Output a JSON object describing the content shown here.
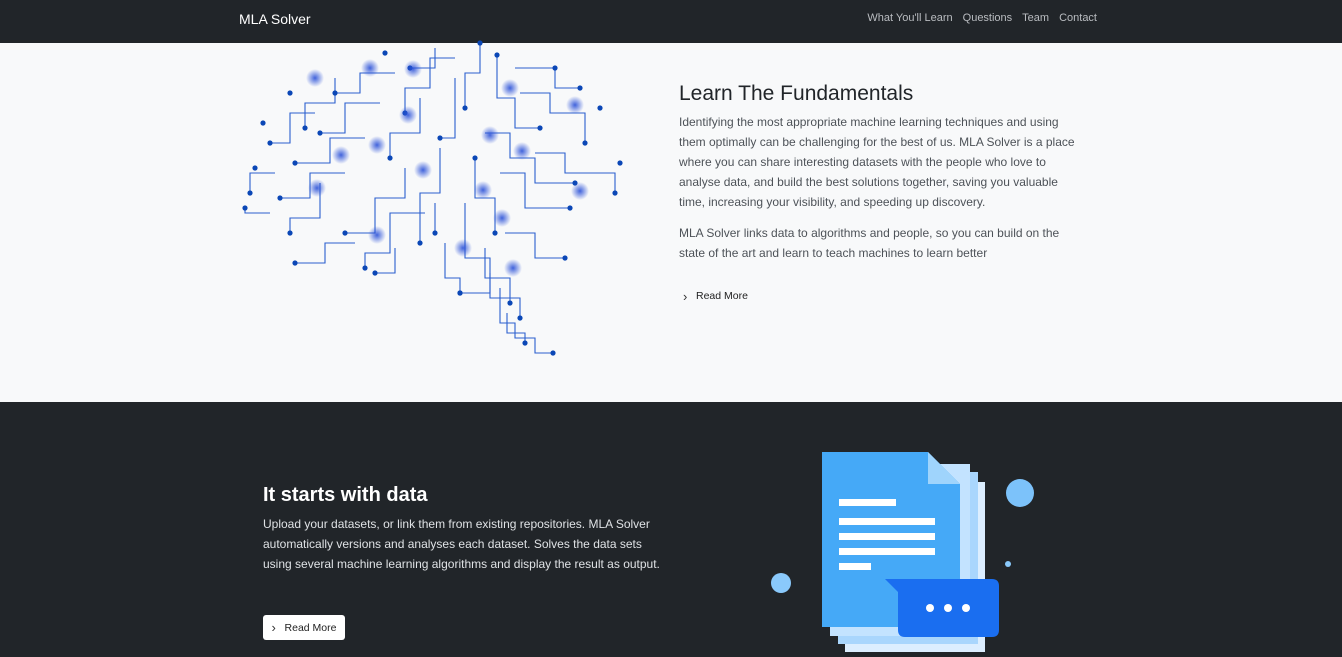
{
  "navbar": {
    "brand": "MLA Solver",
    "links": [
      "What You'll Learn",
      "Questions",
      "Team",
      "Contact"
    ]
  },
  "section_fundamentals": {
    "title": "Learn The Fundamentals",
    "paragraph1": "Identifying the most appropriate machine learning techniques and using them optimally can be challenging for the best of us. MLA Solver is a place where you can share interesting datasets with the people who love to analyse data, and build the best solutions together, saving you valuable time, increasing your visibility, and speeding up discovery.",
    "paragraph2": "MLA Solver links data to algorithms and people, so you can build on the state of the art and learn to teach machines to learn better",
    "read_more": "Read More",
    "illustration_icon": "circuit-brain-illustration"
  },
  "section_data": {
    "title": "It starts with data",
    "paragraph": "Upload your datasets, or link them from existing repositories. MLA Solver automatically versions and analyses each dataset. Solves the data sets using several machine learning algorithms and display the result as output.",
    "read_more": "Read More",
    "illustration_icon": "documents-chat-illustration"
  },
  "colors": {
    "navbar_bg": "#212529",
    "light_bg": "#f8f9fa",
    "circuit_blue": "#1e56c8",
    "doc_blue": "#4aa8f5",
    "chat_blue": "#1a6ef0"
  }
}
